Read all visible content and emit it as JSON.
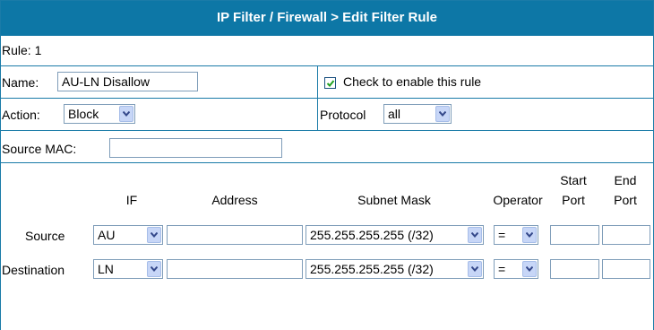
{
  "page": {
    "title": "IP Filter / Firewall > Edit Filter Rule"
  },
  "rule": {
    "label": "Rule: 1"
  },
  "name": {
    "label": "Name:",
    "value": "AU-LN Disallow"
  },
  "enable": {
    "checked": true,
    "label": "Check to enable this rule"
  },
  "action": {
    "label": "Action:",
    "value": "Block"
  },
  "protocol": {
    "label": "Protocol",
    "value": "all"
  },
  "source_mac": {
    "label": "Source MAC:",
    "value": ""
  },
  "table": {
    "headers": {
      "if": "IF",
      "address": "Address",
      "subnet_mask": "Subnet Mask",
      "operator": "Operator",
      "start_port_1": "Start",
      "start_port_2": "Port",
      "end_port_1": "End",
      "end_port_2": "Port"
    },
    "rows": [
      {
        "label": "Source",
        "if": "AU",
        "address": "",
        "subnet_mask": "255.255.255.255 (/32)",
        "operator": "=",
        "start_port": "",
        "end_port": ""
      },
      {
        "label": "Destination",
        "if": "LN",
        "address": "",
        "subnet_mask": "255.255.255.255 (/32)",
        "operator": "=",
        "start_port": "",
        "end_port": ""
      }
    ]
  },
  "colors": {
    "header_bg": "#0d77a6",
    "border": "#1a7ba8",
    "header_text": "#ffffff"
  },
  "icons": {
    "dropdown": "chevron-down-icon",
    "checkbox": "checkmark-icon"
  }
}
